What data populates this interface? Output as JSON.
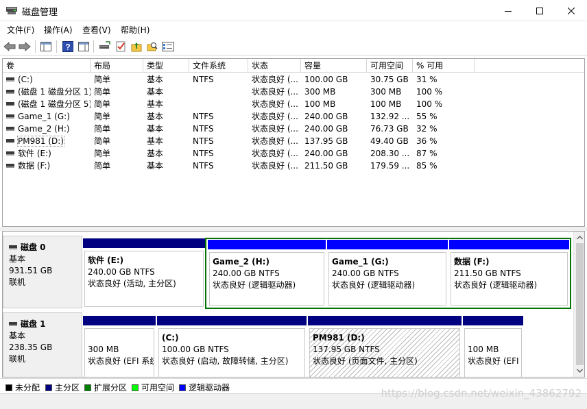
{
  "window": {
    "title": "磁盘管理"
  },
  "menu": {
    "items": [
      {
        "label": "文件(F)"
      },
      {
        "label": "操作(A)"
      },
      {
        "label": "查看(V)"
      },
      {
        "label": "帮助(H)"
      }
    ]
  },
  "volume_table": {
    "columns": [
      "卷",
      "布局",
      "类型",
      "文件系统",
      "状态",
      "容量",
      "可用空间",
      "% 可用"
    ],
    "rows": [
      {
        "volume": "(C:)",
        "layout": "简单",
        "type": "基本",
        "fs": "NTFS",
        "status": "状态良好 (...",
        "capacity": "100.00 GB",
        "free": "30.75 GB",
        "pct": "31 %"
      },
      {
        "volume": "(磁盘 1 磁盘分区 1)",
        "layout": "简单",
        "type": "基本",
        "fs": "",
        "status": "状态良好 (...",
        "capacity": "300 MB",
        "free": "300 MB",
        "pct": "100 %"
      },
      {
        "volume": "(磁盘 1 磁盘分区 5)",
        "layout": "简单",
        "type": "基本",
        "fs": "",
        "status": "状态良好 (...",
        "capacity": "100 MB",
        "free": "100 MB",
        "pct": "100 %"
      },
      {
        "volume": "Game_1 (G:)",
        "layout": "简单",
        "type": "基本",
        "fs": "NTFS",
        "status": "状态良好 (...",
        "capacity": "240.00 GB",
        "free": "132.92 ...",
        "pct": "55 %"
      },
      {
        "volume": "Game_2 (H:)",
        "layout": "简单",
        "type": "基本",
        "fs": "NTFS",
        "status": "状态良好 (...",
        "capacity": "240.00 GB",
        "free": "76.73 GB",
        "pct": "32 %"
      },
      {
        "volume": "PM981 (D:)",
        "layout": "简单",
        "type": "基本",
        "fs": "NTFS",
        "status": "状态良好 (...",
        "capacity": "137.95 GB",
        "free": "49.40 GB",
        "pct": "36 %"
      },
      {
        "volume": "软件 (E:)",
        "layout": "简单",
        "type": "基本",
        "fs": "NTFS",
        "status": "状态良好 (...",
        "capacity": "240.00 GB",
        "free": "208.30 ...",
        "pct": "87 %"
      },
      {
        "volume": "数据 (F:)",
        "layout": "简单",
        "type": "基本",
        "fs": "NTFS",
        "status": "状态良好 (...",
        "capacity": "211.50 GB",
        "free": "179.59 ...",
        "pct": "85 %"
      }
    ]
  },
  "disks": [
    {
      "name": "磁盘 0",
      "kind": "基本",
      "size": "931.51 GB",
      "state": "联机",
      "partitions": [
        {
          "name": "软件  (E:)",
          "size": "240.00 GB NTFS",
          "status": "状态良好 (活动, 主分区)",
          "bar": "primary"
        },
        {
          "name": "Game_2  (H:)",
          "size": "240.00 GB NTFS",
          "status": "状态良好 (逻辑驱动器)",
          "bar": "logical"
        },
        {
          "name": "Game_1  (G:)",
          "size": "240.00 GB NTFS",
          "status": "状态良好 (逻辑驱动器)",
          "bar": "logical"
        },
        {
          "name": "数据  (F:)",
          "size": "211.50 GB NTFS",
          "status": "状态良好 (逻辑驱动器)",
          "bar": "logical"
        }
      ]
    },
    {
      "name": "磁盘 1",
      "kind": "基本",
      "size": "238.35 GB",
      "state": "联机",
      "partitions": [
        {
          "name": "",
          "size": "300 MB",
          "status": "状态良好 (EFI 系统分区)",
          "bar": "primary"
        },
        {
          "name": "(C:)",
          "size": "100.00 GB NTFS",
          "status": "状态良好 (启动, 故障转储, 主分区)",
          "bar": "primary"
        },
        {
          "name": "PM981  (D:)",
          "size": "137.95 GB NTFS",
          "status": "状态良好 (页面文件, 主分区)",
          "bar": "primary"
        },
        {
          "name": "",
          "size": "100 MB",
          "status": "状态良好 (EFI 系统分区)",
          "bar": "primary"
        }
      ]
    }
  ],
  "legend": [
    {
      "label": "未分配",
      "color": "#000000"
    },
    {
      "label": "主分区",
      "color": "#000080"
    },
    {
      "label": "扩展分区",
      "color": "#008000"
    },
    {
      "label": "可用空间",
      "color": "#00ff00"
    },
    {
      "label": "逻辑驱动器",
      "color": "#0000ff"
    }
  ],
  "watermark": "https://blog.csdn.net/weixin_43862792",
  "colors": {
    "primary": "#000080",
    "logical": "#0000ff",
    "extended": "#007500"
  }
}
